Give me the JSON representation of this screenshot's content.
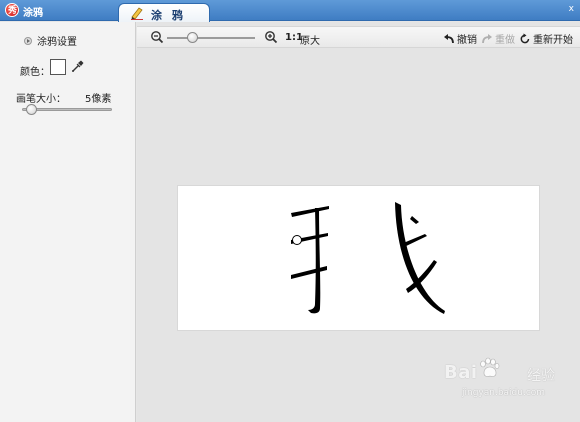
{
  "window": {
    "app_title": "涂鸦",
    "logo_glyph": "秀",
    "tab_label": "涂 鸦",
    "close_glyph": "x"
  },
  "sidebar": {
    "section_title": "涂鸦设置",
    "color_label": "颜色：",
    "brush_size_label": "画笔大小：",
    "brush_size_value": "5像素",
    "brush_size_px": 5,
    "selected_color": "#ffffff"
  },
  "toolbar": {
    "ratio_label": "1:1",
    "original_size_label": "原大",
    "undo_label": "撤销",
    "redo_label": "重做",
    "restart_label": "重新开始"
  },
  "canvas": {
    "stroke_color": "#000000"
  },
  "watermark": {
    "brand": "Bai",
    "brand_suffix": "经验",
    "url": "jingyan.baidu.com"
  },
  "colors": {
    "titlebar": "#4a87cc",
    "sidebar_bg": "#f3f3f3",
    "workspace_bg": "#e4e4e4",
    "canvas_bg": "#ffffff"
  }
}
